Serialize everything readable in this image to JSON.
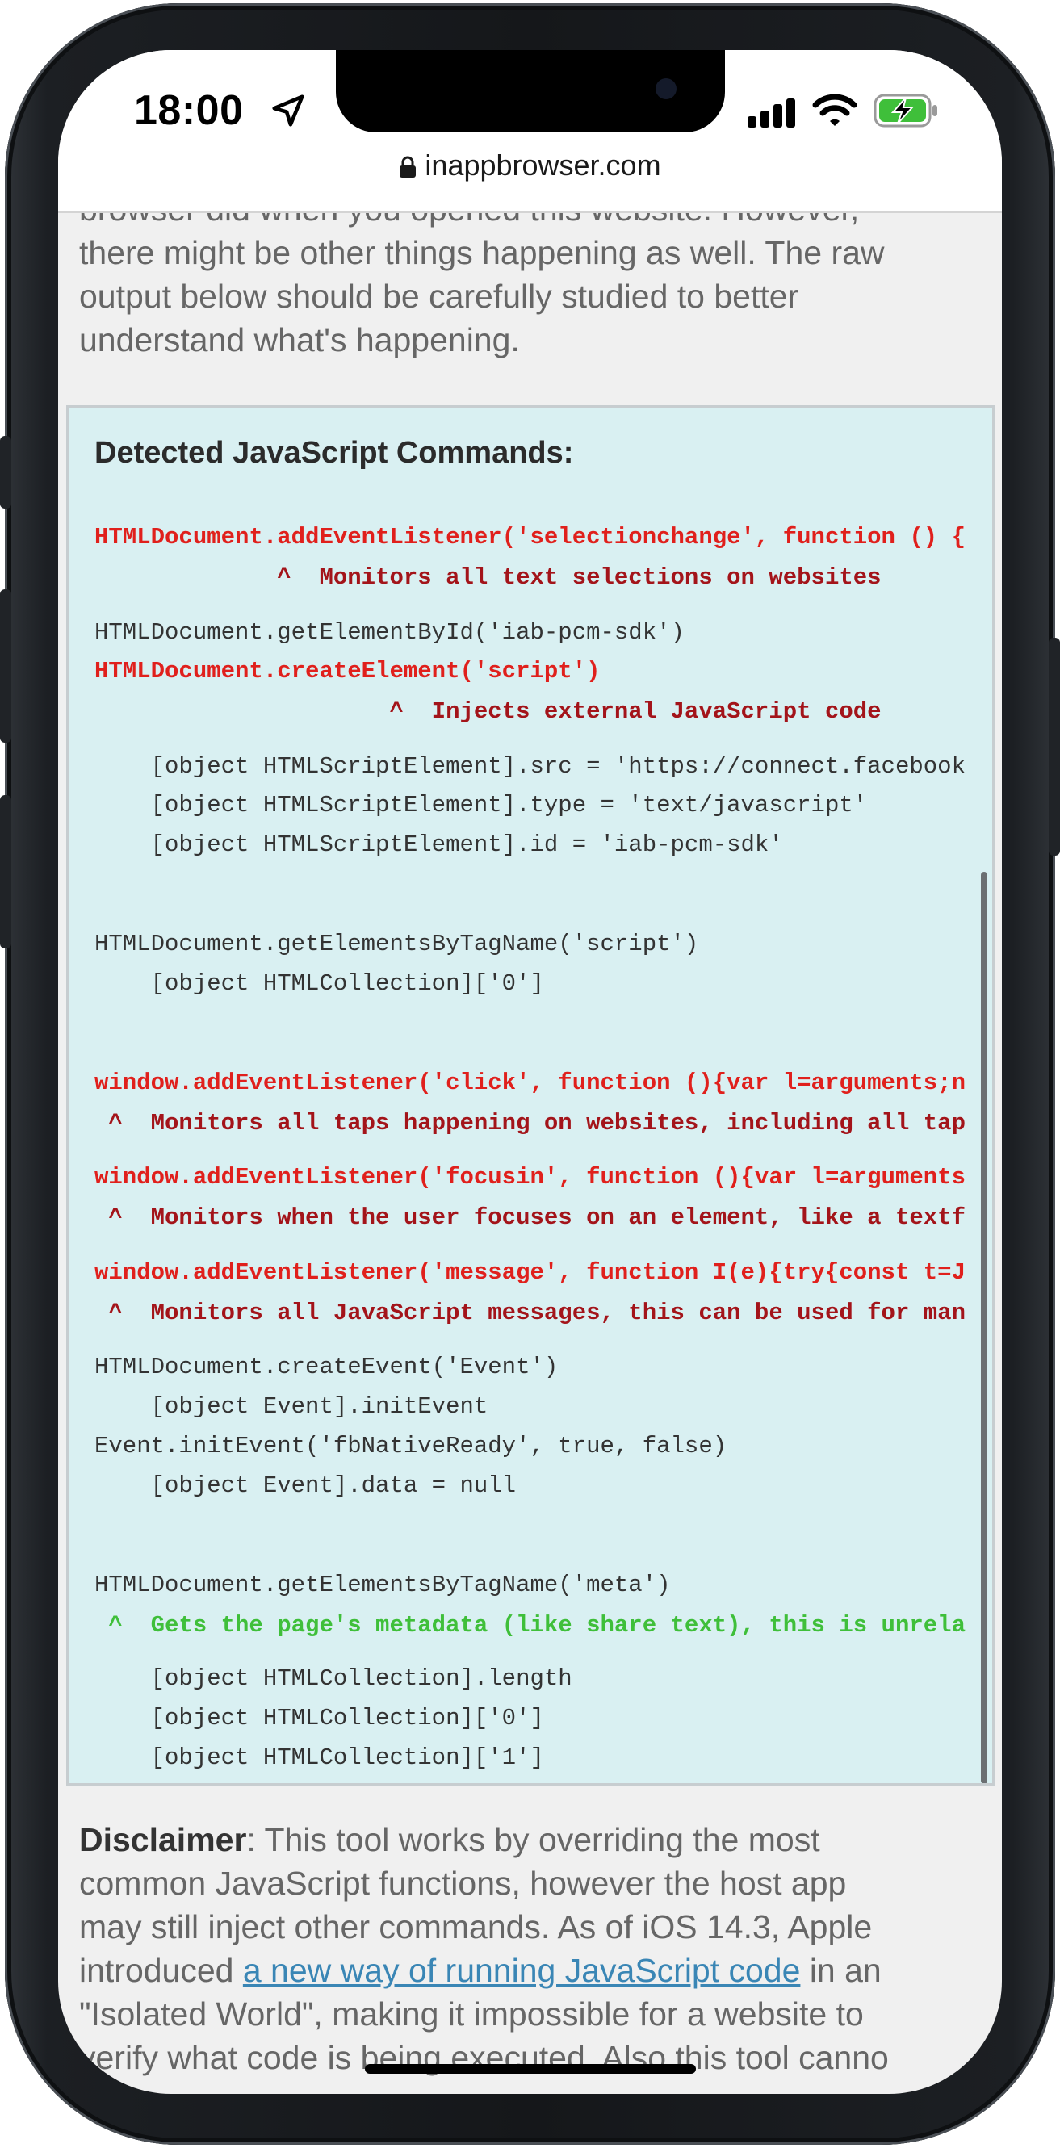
{
  "status_bar": {
    "time": "18:00",
    "icons": [
      "location-arrow-icon",
      "cellular-signal-icon",
      "wifi-icon",
      "battery-charging-icon"
    ],
    "battery_color": "#3fbf3a"
  },
  "url_bar": {
    "domain": "inappbrowser.com",
    "icon": "lock-icon"
  },
  "intro": {
    "line1": "browser did when you opened this website. However,",
    "line2": "there might be other things happening as well. The raw",
    "line3": "output below should be carefully studied to better",
    "line4": "understand what's happening."
  },
  "js_box": {
    "title": "Detected JavaScript Commands:",
    "lines": [
      "HTMLDocument.addEventListener('selectionchange', function () {",
      "             ^  Monitors all text selections on websites",
      "HTMLDocument.getElementById('iab-pcm-sdk')",
      "HTMLDocument.createElement('script')",
      "                     ^  Injects external JavaScript code",
      "    [object HTMLScriptElement].src = 'https://connect.facebook",
      "    [object HTMLScriptElement].type = 'text/javascript'",
      "    [object HTMLScriptElement].id = 'iab-pcm-sdk'",
      "HTMLDocument.getElementsByTagName('script')",
      "    [object HTMLCollection]['0']",
      "window.addEventListener('click', function (){var l=arguments;n",
      " ^  Monitors all taps happening on websites, including all tap",
      "window.addEventListener('focusin', function (){var l=arguments",
      " ^  Monitors when the user focuses on an element, like a textf",
      "window.addEventListener('message', function I(e){try{const t=J",
      " ^  Monitors all JavaScript messages, this can be used for man",
      "HTMLDocument.createEvent('Event')",
      "    [object Event].initEvent",
      "Event.initEvent('fbNativeReady', true, false)",
      "    [object Event].data = null",
      "HTMLDocument.getElementsByTagName('meta')",
      " ^  Gets the page's metadata (like share text), this is unrela",
      "    [object HTMLCollection].length",
      "    [object HTMLCollection]['0']",
      "    [object HTMLCollection]['1']"
    ]
  },
  "disclaimer": {
    "label": "Disclaimer",
    "text1": ": This tool works by overriding the most",
    "line2": "common JavaScript functions, however the host app",
    "line3": "may still inject other commands. As of iOS 14.3, Apple",
    "line4_pre": "introduced ",
    "link": "a new way of running JavaScript code",
    "line4_post": " in an",
    "line5": "\"Isolated World\", making it impossible for a website to",
    "line6": "verify what code is being executed. Also this tool canno"
  },
  "colors": {
    "command_red": "#e0201c",
    "note_dark_red": "#a3141a",
    "note_green": "#3fbf3a",
    "box_bg": "#d9f0f2",
    "link": "#3a86b5"
  }
}
